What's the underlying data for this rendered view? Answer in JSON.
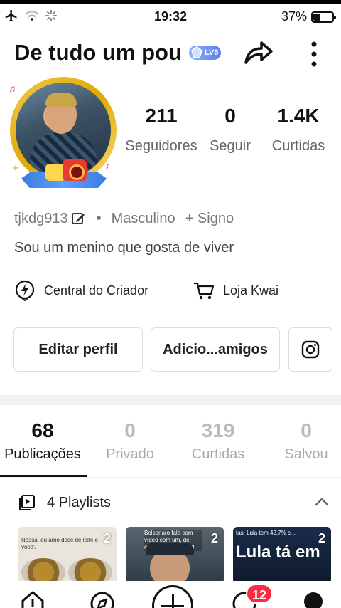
{
  "status_bar": {
    "time": "19:32",
    "battery": "37%",
    "battery_level": 0.37
  },
  "header": {
    "title": "De tudo um pou",
    "level_badge": "LV5"
  },
  "stats": [
    {
      "value": "211",
      "label": "Seguidores"
    },
    {
      "value": "0",
      "label": "Seguir"
    },
    {
      "value": "1.4K",
      "label": "Curtidas"
    }
  ],
  "profile": {
    "username": "tjkdg913",
    "separator": "•",
    "gender": "Masculino",
    "sign": "+ Signo",
    "bio": "Sou um menino que gosta de viver"
  },
  "quick_links": {
    "creator_center": "Central do Criador",
    "shop": "Loja Kwai"
  },
  "buttons": {
    "edit_profile": "Editar perfil",
    "add_friends": "Adicio...amigos"
  },
  "tabs": [
    {
      "count": "68",
      "label": "Publicações",
      "active": true
    },
    {
      "count": "0",
      "label": "Privado",
      "active": false
    },
    {
      "count": "319",
      "label": "Curtidas",
      "active": false
    },
    {
      "count": "0",
      "label": "Salvou",
      "active": false
    }
  ],
  "playlists": {
    "label": "4 Playlists",
    "items": [
      {
        "count": "2",
        "caption": "Nossa, eu amo doce de leite e você?",
        "big_text": ""
      },
      {
        "count": "2",
        "caption": "Bolsonaro fala com vídeo com um, de encima de outro Bill",
        "big_text": ""
      },
      {
        "count": "2",
        "caption": "tas: Lula tem 42,7% c...",
        "big_text": "Lula tá em"
      }
    ]
  },
  "bottom_nav": {
    "notifications_count": "12"
  },
  "colors": {
    "accent_red": "#ff2a3d",
    "badge_blue": "#5b7fe8",
    "avatar_ring": "#e0a800"
  }
}
